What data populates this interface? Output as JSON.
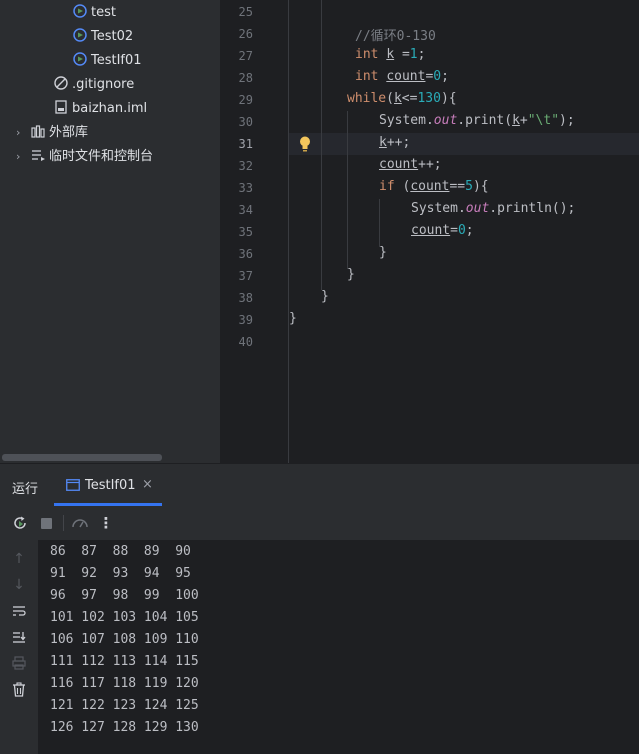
{
  "project_tree": {
    "items": [
      {
        "label": "test",
        "icon": "java-class-run-icon"
      },
      {
        "label": "Test02",
        "icon": "java-class-run-icon"
      },
      {
        "label": "TestIf01",
        "icon": "java-class-run-icon"
      },
      {
        "label": ".gitignore",
        "icon": "ignore-file-icon"
      },
      {
        "label": "baizhan.iml",
        "icon": "iml-file-icon"
      },
      {
        "label": "外部库",
        "icon": "library-icon"
      },
      {
        "label": "临时文件和控制台",
        "icon": "scratches-icon"
      }
    ]
  },
  "editor": {
    "line_numbers": [
      "25",
      "26",
      "27",
      "28",
      "29",
      "30",
      "31",
      "32",
      "33",
      "34",
      "35",
      "36",
      "37",
      "38",
      "39",
      "40"
    ],
    "current_line": "31",
    "code": {
      "l26_comment": "//循环0-130",
      "l27_type": "int",
      "l27_var": "k",
      "l27_op": " =",
      "l27_val": "1",
      "l27_end": ";",
      "l28_type": "int",
      "l28_var": "count",
      "l28_op": "=",
      "l28_val": "0",
      "l28_end": ";",
      "l29_kw": "while",
      "l29_open": "(",
      "l29_var": "k",
      "l29_op": "<=",
      "l29_val": "130",
      "l29_end": "){",
      "l30_sys": "System.",
      "l30_out": "out",
      "l30_call": ".print(",
      "l30_var": "k",
      "l30_plus": "+",
      "l30_str": "\"\\t\"",
      "l30_end": ");",
      "l31_var": "k",
      "l31_end": "++;",
      "l32_var": "count",
      "l32_end": "++;",
      "l33_kw": "if",
      "l33_open": " (",
      "l33_var": "count",
      "l33_op": "==",
      "l33_val": "5",
      "l33_end": "){",
      "l34_sys": "System.",
      "l34_out": "out",
      "l34_call": ".println();",
      "l35_var": "count",
      "l35_op": "=",
      "l35_val": "0",
      "l35_end": ";",
      "l36": "}",
      "l37": "}",
      "l38": "}",
      "l39": "}"
    }
  },
  "run_panel": {
    "title": "运行",
    "tab_label": "TestIf01",
    "console_lines": [
      "86  87  88  89  90",
      "91  92  93  94  95",
      "96  97  98  99  100",
      "101 102 103 104 105",
      "106 107 108 109 110",
      "111 112 113 114 115",
      "116 117 118 119 120",
      "121 122 123 124 125",
      "126 127 128 129 130"
    ]
  },
  "colors": {
    "accent": "#3574f0",
    "keyword": "#cf8e6d",
    "number": "#2aacb8",
    "string": "#6aab73",
    "field": "#c77dbb"
  }
}
